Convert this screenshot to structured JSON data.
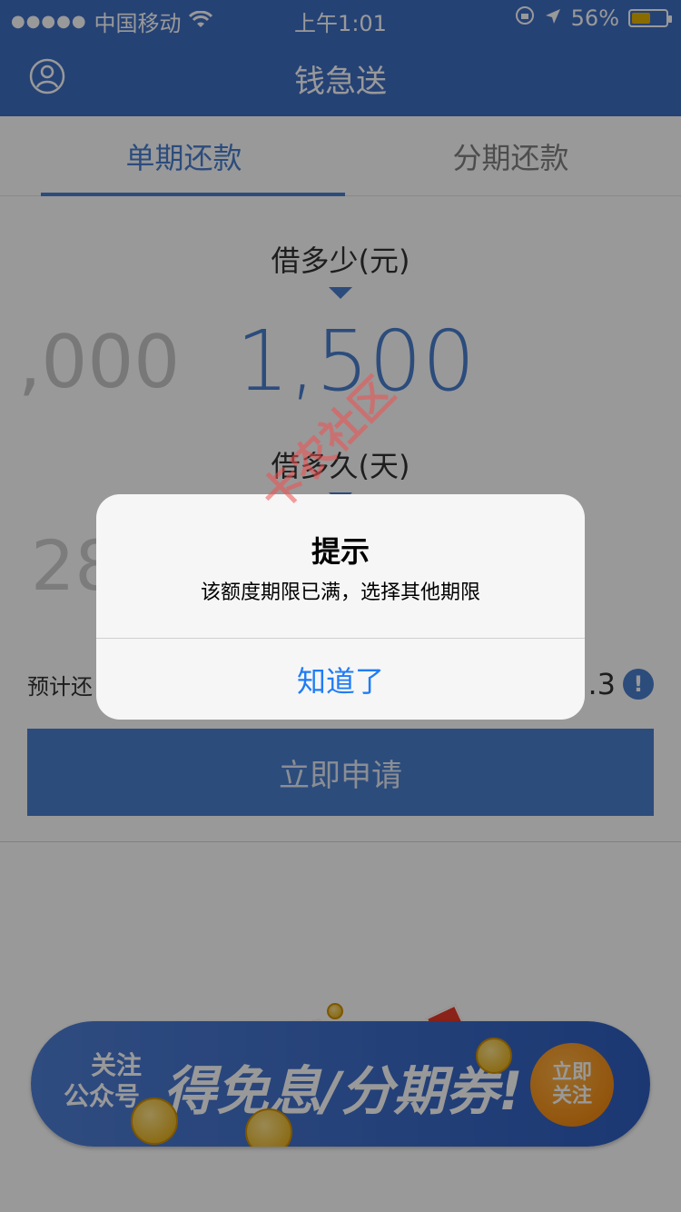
{
  "status_bar": {
    "signal": "●●●●●",
    "carrier": "中国移动",
    "time": "上午1:01",
    "battery": "56%",
    "battery_level": 0.56
  },
  "nav": {
    "title": "钱急送"
  },
  "tabs": [
    {
      "label": "单期还款",
      "active": true
    },
    {
      "label": "分期还款",
      "active": false
    }
  ],
  "amount": {
    "label": "借多少(元)",
    "prev_value": ",000",
    "current_value": "1,500"
  },
  "duration": {
    "label": "借多久(天)",
    "prev_value": "28"
  },
  "repay": {
    "label": "预计还",
    "value_suffix": ".3",
    "info_icon": "info-icon"
  },
  "apply_button": "立即申请",
  "banner": {
    "small_line1": "关注",
    "small_line2": "公众号",
    "headline": "得免息/分期券!",
    "follow_line1": "立即",
    "follow_line2": "关注"
  },
  "dialog": {
    "title": "提示",
    "message": "该额度期限已满，选择其他期限",
    "button": "知道了"
  },
  "watermark": "卡农社区",
  "colors": {
    "brand": "#3f6fc4",
    "accent": "#4a7fcf",
    "dialog_button": "#1f7cf7"
  }
}
